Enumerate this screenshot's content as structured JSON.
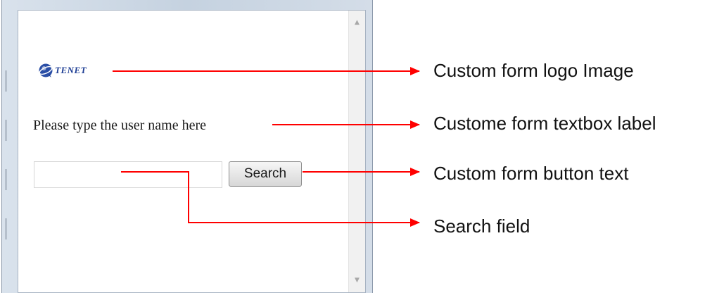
{
  "form": {
    "logo_text": "TENET",
    "textbox_label": "Please type the user name here",
    "search_value": "",
    "search_button_label": "Search"
  },
  "annotations": [
    {
      "text": "Custom form logo Image"
    },
    {
      "text": "Custome form textbox label"
    },
    {
      "text": "Custom form button text"
    },
    {
      "text": "Search field"
    }
  ],
  "colors": {
    "arrow": "#ff0000",
    "logo": "#1f3f95"
  },
  "icons": {
    "logo": "globe-logo-icon",
    "scroll_up": "scroll-up-arrow-icon",
    "scroll_down": "scroll-down-arrow-icon"
  }
}
